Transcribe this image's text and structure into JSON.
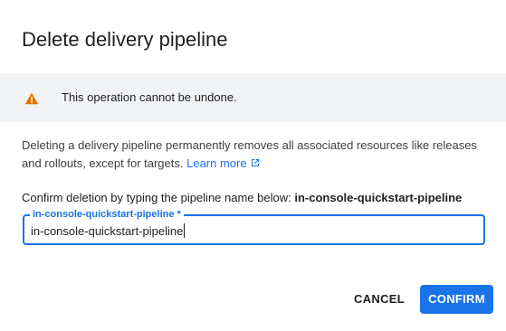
{
  "dialog": {
    "title": "Delete delivery pipeline",
    "warning": {
      "icon": "warning-icon",
      "color": "#e37400",
      "text": "This operation cannot be undone."
    },
    "description": {
      "text": "Deleting a delivery pipeline permanently removes all associated resources like releases and rollouts, except for targets.",
      "link_label": "Learn more",
      "link_icon": "external-link-icon"
    },
    "confirm_prompt": {
      "text": "Confirm deletion by typing the pipeline name below:",
      "pipeline_name": "in-console-quickstart-pipeline"
    },
    "field": {
      "label": "in-console-quickstart-pipeline *",
      "value": "in-console-quickstart-pipeline"
    },
    "buttons": {
      "cancel": "CANCEL",
      "confirm": "CONFIRM"
    },
    "colors": {
      "accent": "#1a73e8",
      "banner_bg": "#f1f3f4"
    }
  }
}
